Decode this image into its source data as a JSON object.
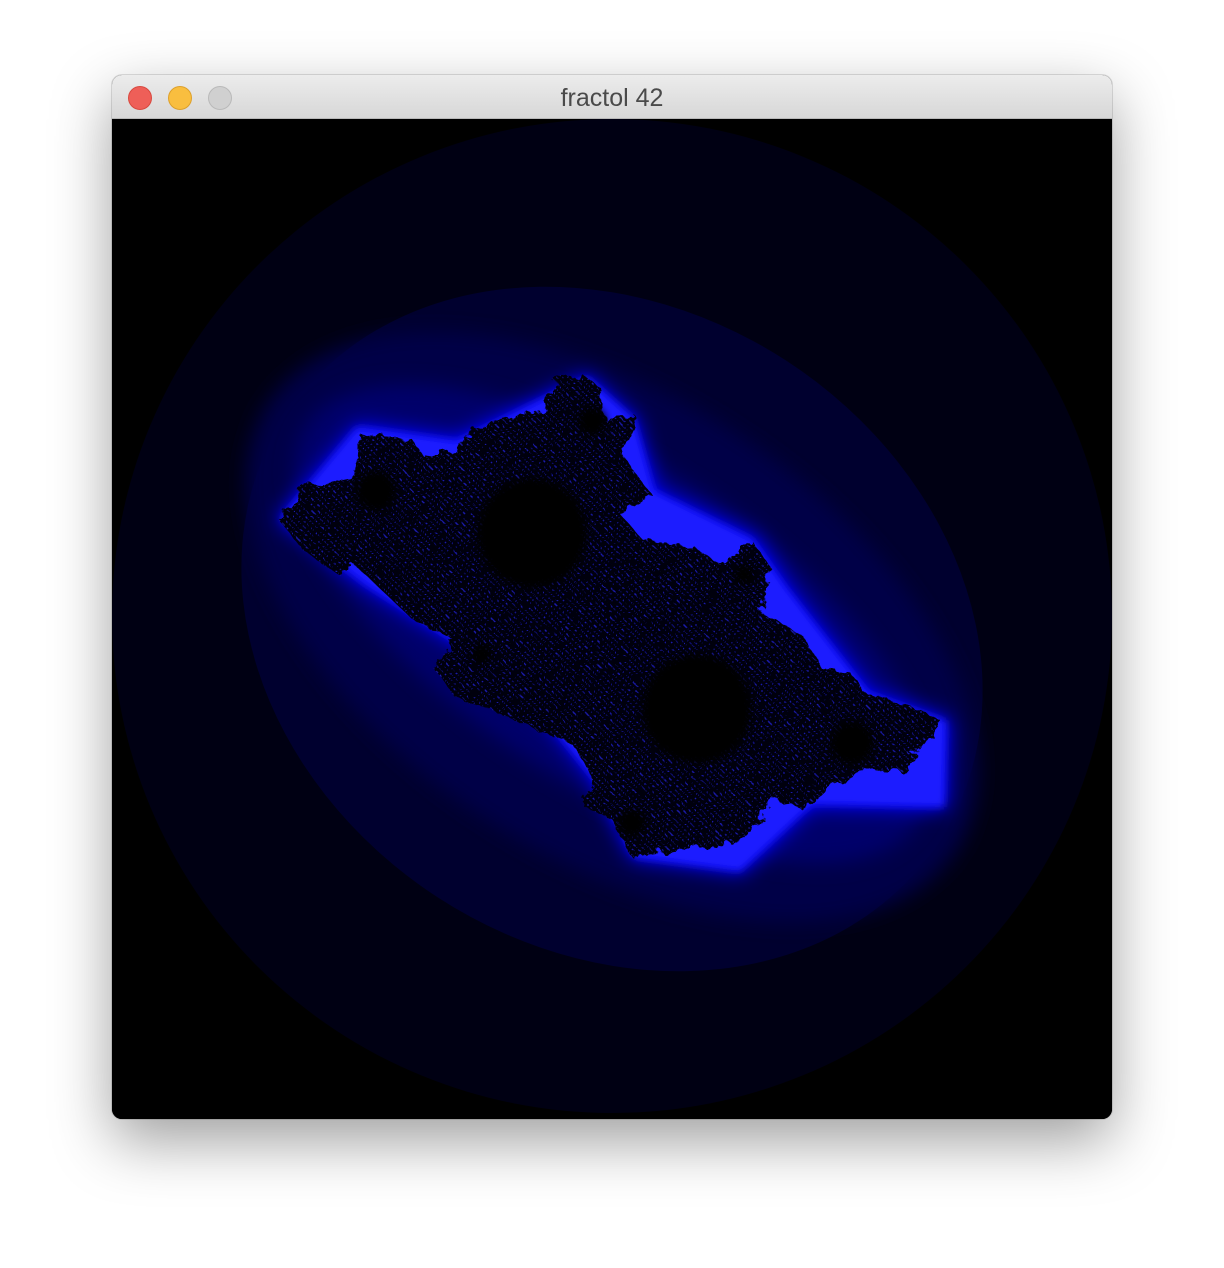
{
  "window": {
    "title": "fractol 42",
    "controls": [
      {
        "name": "close",
        "color": "#ee5f58"
      },
      {
        "name": "minimize",
        "color": "#f9be3f"
      },
      {
        "name": "zoom",
        "color": "#d0d0d0"
      }
    ]
  },
  "render": {
    "fractal": "julia",
    "background_color": "#000000",
    "palette": [
      "#000010",
      "#000030",
      "#00005a",
      "#0000a0",
      "#0000ff"
    ],
    "set_color": "#000000"
  }
}
